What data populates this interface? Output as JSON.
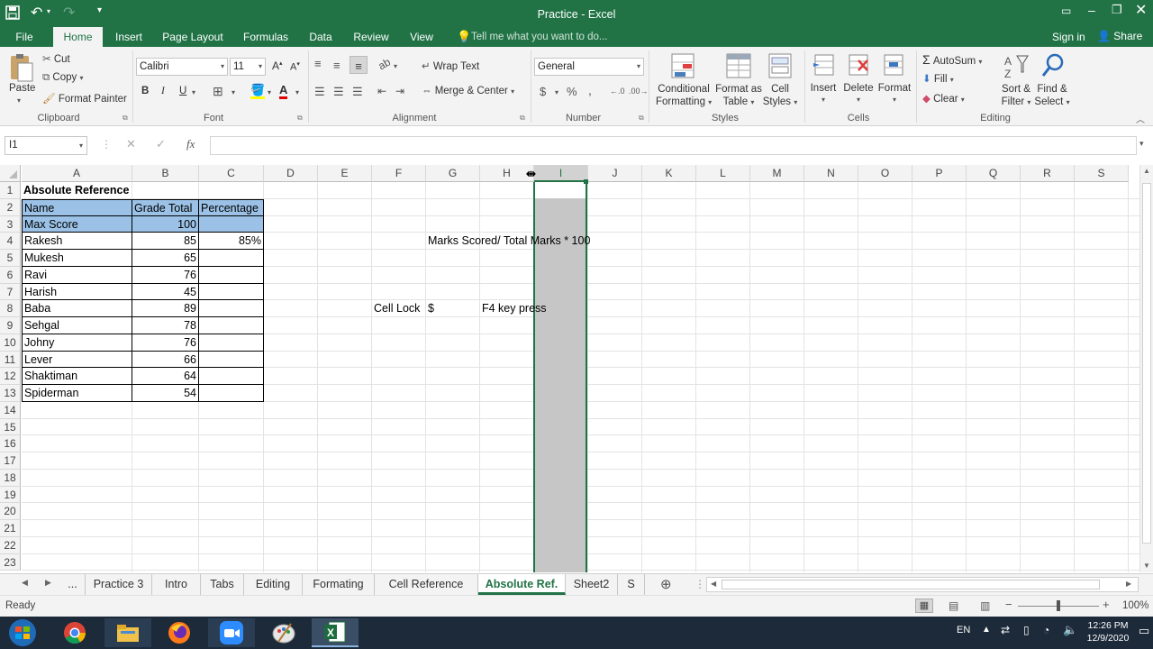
{
  "title": "Practice - Excel",
  "ribbon_tabs": [
    "File",
    "Home",
    "Insert",
    "Page Layout",
    "Formulas",
    "Data",
    "Review",
    "View"
  ],
  "tell_me": "Tell me what you want to do...",
  "sign_in": "Sign in",
  "share": "Share",
  "clipboard": {
    "paste": "Paste",
    "cut": "Cut",
    "copy": "Copy",
    "format_painter": "Format Painter",
    "label": "Clipboard"
  },
  "font": {
    "name": "Calibri",
    "size": "11",
    "bold": "B",
    "italic": "I",
    "underline": "U",
    "label": "Font"
  },
  "alignment": {
    "wrap": "Wrap Text",
    "merge": "Merge & Center",
    "label": "Alignment"
  },
  "number": {
    "format": "General",
    "currency": "$",
    "percent": "%",
    "comma": ",",
    "label": "Number"
  },
  "styles": {
    "conditional": [
      "Conditional",
      "Formatting"
    ],
    "format_table": [
      "Format as",
      "Table"
    ],
    "cell_styles": [
      "Cell",
      "Styles"
    ],
    "label": "Styles"
  },
  "cells": {
    "insert": "Insert",
    "delete": "Delete",
    "format": "Format",
    "label": "Cells"
  },
  "editing": {
    "autosum": "AutoSum",
    "fill": "Fill",
    "clear": "Clear",
    "sort": [
      "Sort &",
      "Filter"
    ],
    "find": [
      "Find &",
      "Select"
    ],
    "label": "Editing"
  },
  "name_box": "I1",
  "fx": "fx",
  "columns": [
    "A",
    "B",
    "C",
    "D",
    "E",
    "F",
    "G",
    "H",
    "I",
    "J",
    "K",
    "L",
    "M",
    "N",
    "O",
    "P",
    "Q",
    "R",
    "S"
  ],
  "rows": [
    "1",
    "2",
    "3",
    "4",
    "5",
    "6",
    "7",
    "8",
    "9",
    "10",
    "11",
    "12",
    "13",
    "14",
    "15",
    "16",
    "17",
    "18",
    "19",
    "20",
    "21",
    "22",
    "23"
  ],
  "cells_data": {
    "a1": "Absolute Reference",
    "headers": [
      "Name",
      "Grade Total",
      "Percentage"
    ],
    "max_score": {
      "name": "Max Score",
      "value": "100"
    },
    "students": [
      {
        "name": "Rakesh",
        "total": "85",
        "pct": "85%"
      },
      {
        "name": "Mukesh",
        "total": "65",
        "pct": ""
      },
      {
        "name": "Ravi",
        "total": "76",
        "pct": ""
      },
      {
        "name": "Harish",
        "total": "45",
        "pct": ""
      },
      {
        "name": "Baba",
        "total": "89",
        "pct": ""
      },
      {
        "name": "Sehgal",
        "total": "78",
        "pct": ""
      },
      {
        "name": "Johny",
        "total": "76",
        "pct": ""
      },
      {
        "name": "Lever",
        "total": "66",
        "pct": ""
      },
      {
        "name": "Shaktiman",
        "total": "64",
        "pct": ""
      },
      {
        "name": "Spiderman",
        "total": "54",
        "pct": ""
      }
    ],
    "g4": "Marks Scored/ Total Marks * 100",
    "f8": "Cell Lock",
    "g8": "$",
    "h8": "F4 key press"
  },
  "sheet_nav": {
    "ellipsis": "..."
  },
  "sheet_tabs": [
    "Practice 3",
    "Intro",
    "Tabs",
    "Editing",
    "Formating",
    "Cell Reference",
    "Absolute Ref.",
    "Sheet2",
    "S"
  ],
  "active_sheet": "Absolute Ref.",
  "status": "Ready",
  "zoom": "100%",
  "tray": {
    "lang": "EN",
    "time": "12:26 PM",
    "date": "12/9/2020"
  },
  "colors": {
    "accent": "#217346",
    "header_fill": "#9bc2e6"
  }
}
